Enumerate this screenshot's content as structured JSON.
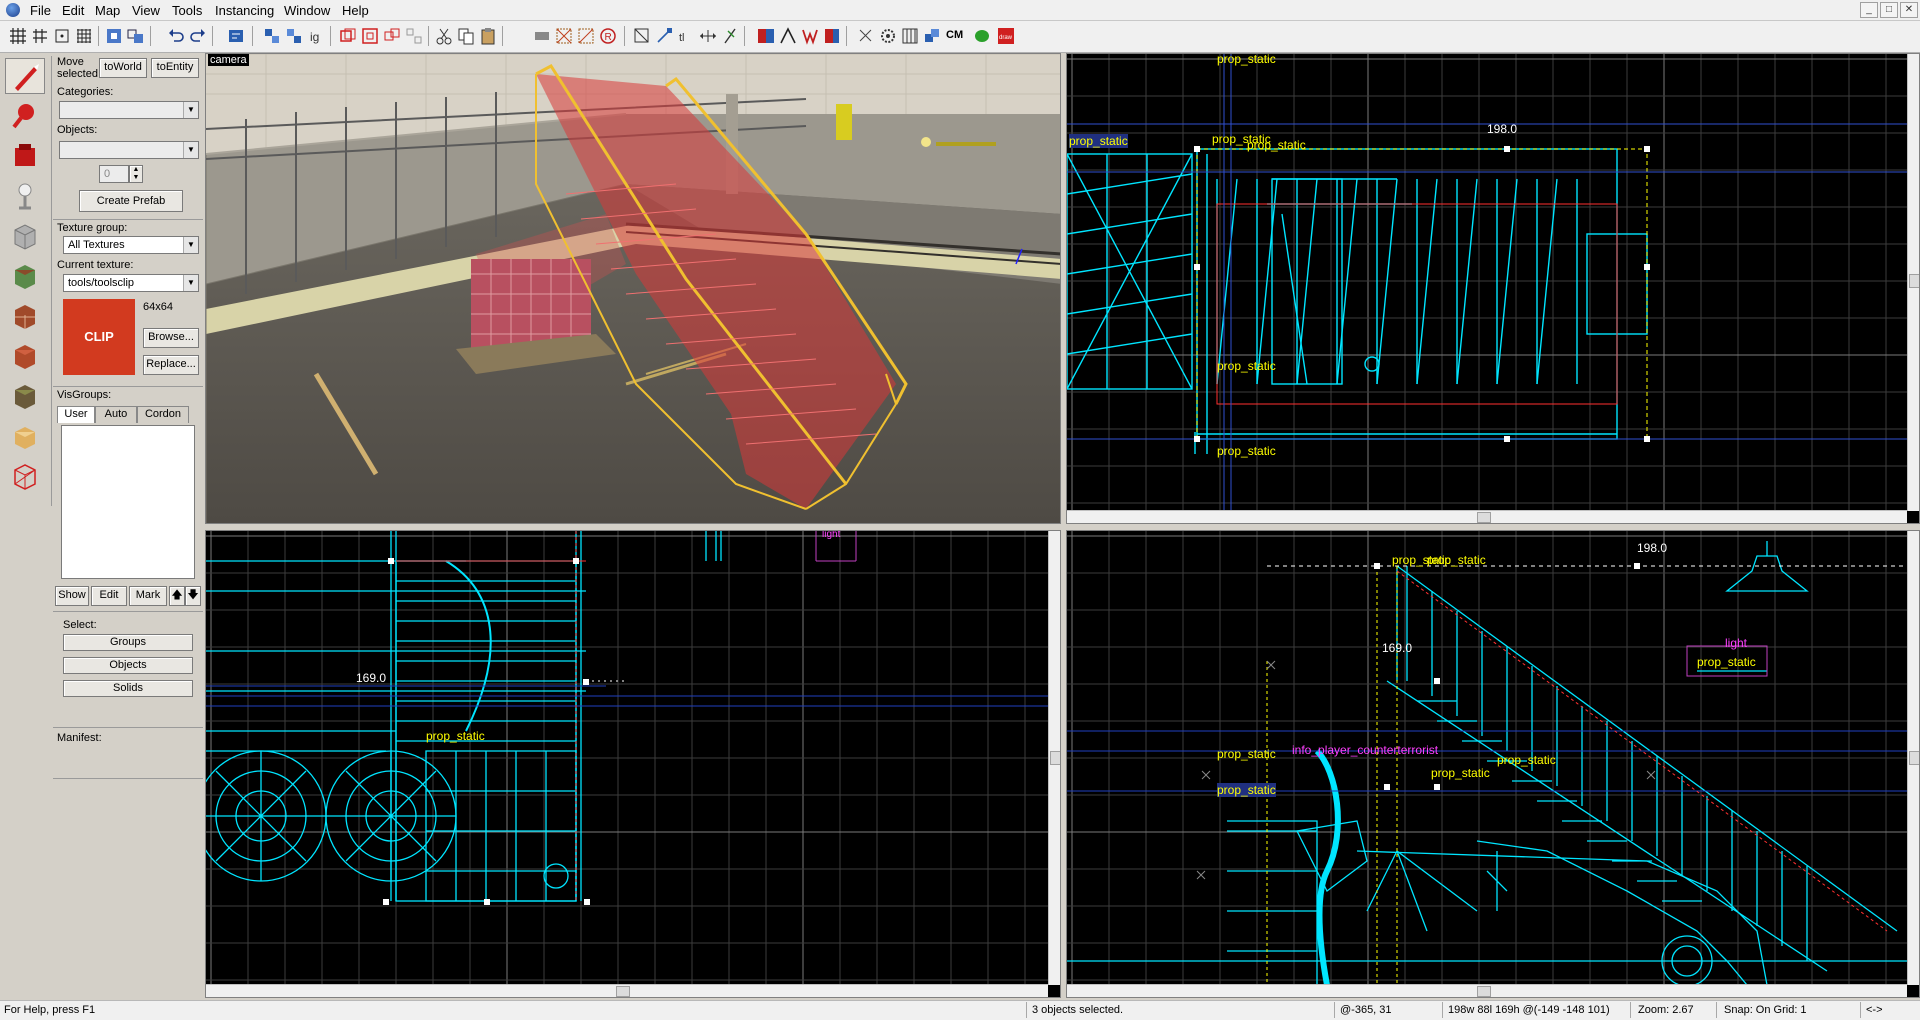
{
  "menubar": {
    "items": [
      "File",
      "Edit",
      "Map",
      "View",
      "Tools",
      "Instancing",
      "Window",
      "Help"
    ],
    "window_buttons": [
      "_",
      "□",
      "✕"
    ]
  },
  "toolbar": {
    "cm_label": "CM"
  },
  "side_panel": {
    "move_selected": "Move selected:",
    "to_world": "toWorld",
    "to_entity": "toEntity",
    "categories_label": "Categories:",
    "objects_label": "Objects:",
    "objects_count": "0",
    "create_prefab": "Create Prefab",
    "texture_group_label": "Texture group:",
    "texture_group_value": "All Textures",
    "current_texture_label": "Current texture:",
    "current_texture_value": "tools/toolsclip",
    "texture_size": "64x64",
    "texture_preview_text": "CLIP",
    "browse": "Browse...",
    "replace": "Replace...",
    "visgroups_label": "VisGroups:",
    "tabs": [
      "User",
      "Auto",
      "Cordon"
    ],
    "show": "Show",
    "edit": "Edit",
    "mark": "Mark",
    "up": "🡅",
    "down": "🡇",
    "select_label": "Select:",
    "groups": "Groups",
    "objects": "Objects",
    "solids": "Solids",
    "manifest_label": "Manifest:"
  },
  "viewports": {
    "camera": {
      "label": "camera"
    },
    "top": {
      "dimension": "198.0",
      "labels": [
        "prop_static",
        "prop_static",
        "prop_static",
        "prop_static",
        "prop_static",
        "prop_static"
      ]
    },
    "front": {
      "dimension": "169.0",
      "labels": [
        "prop_static",
        "light"
      ]
    },
    "side": {
      "dimension_top": "198.0",
      "dimension_side": "169.0",
      "labels": [
        "prop_static",
        "prop_static",
        "prop_static",
        "prop_static",
        "prop_static",
        "prop_static",
        "info_player_counterterrorist",
        "light",
        "prop_static"
      ]
    }
  },
  "statusbar": {
    "help": "For Help, press F1",
    "selection": "3 objects selected.",
    "coords": "@-365, 31",
    "size": "198w 88l 169h @(-149 -148 101)",
    "zoom": "Zoom: 2.67",
    "snap": "Snap: On Grid: 1",
    "nav": "<->"
  },
  "colors": {
    "wire": "#00e5ff",
    "grid": "#3c3c3c",
    "grid_major": "#7a7a7a",
    "label_yellow": "#ffff00",
    "label_magenta": "#ff40ff",
    "clip_red": "#d23a1f"
  }
}
